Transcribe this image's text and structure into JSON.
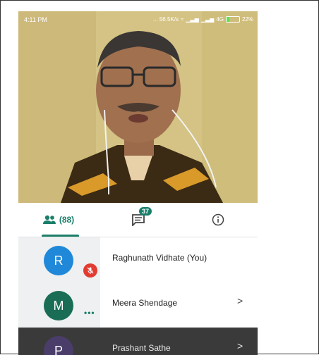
{
  "status_bar": {
    "time": "4:11 PM",
    "speed": "... 56.5K/s",
    "network": "4G",
    "battery": "22%",
    "battery_level": 0.22
  },
  "video": {
    "participant_icon": "person-video"
  },
  "tabs": {
    "people_count": "(88)",
    "chat_count": "37",
    "people_icon": "people-icon",
    "chat_icon": "chat-icon",
    "info_icon": "info-icon",
    "active": "people"
  },
  "participants": [
    {
      "initial": "R",
      "name": "Raghunath Vidhate (You)",
      "avatar_color": "#1f88d8",
      "muted": true
    },
    {
      "initial": "M",
      "name": "Meera Shendage",
      "avatar_color": "#1a6d55",
      "chevron": ">"
    },
    {
      "initial": "P",
      "name": "Prashant Sathe",
      "avatar_color": "#4b3d6a",
      "chevron": ">"
    }
  ],
  "colors": {
    "accent": "#1a7f6a",
    "mute": "#e23c32"
  }
}
